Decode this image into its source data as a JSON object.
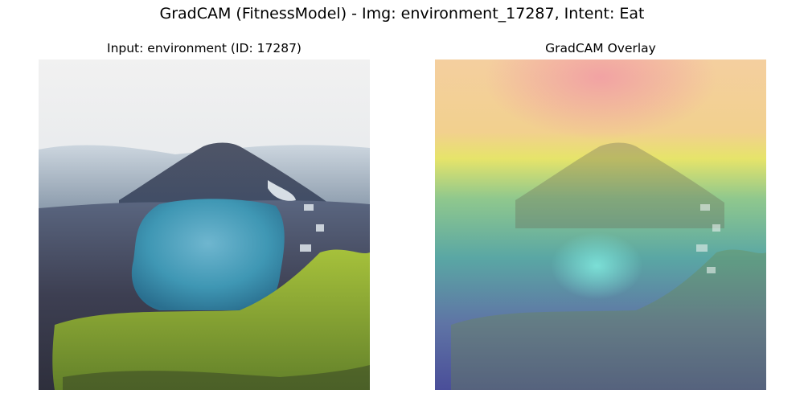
{
  "figure": {
    "title": "GradCAM (FitnessModel) - Img: environment_17287, Intent: Eat"
  },
  "panels": [
    {
      "title": "Input: environment (ID: 17287)"
    },
    {
      "title": "GradCAM Overlay"
    }
  ]
}
